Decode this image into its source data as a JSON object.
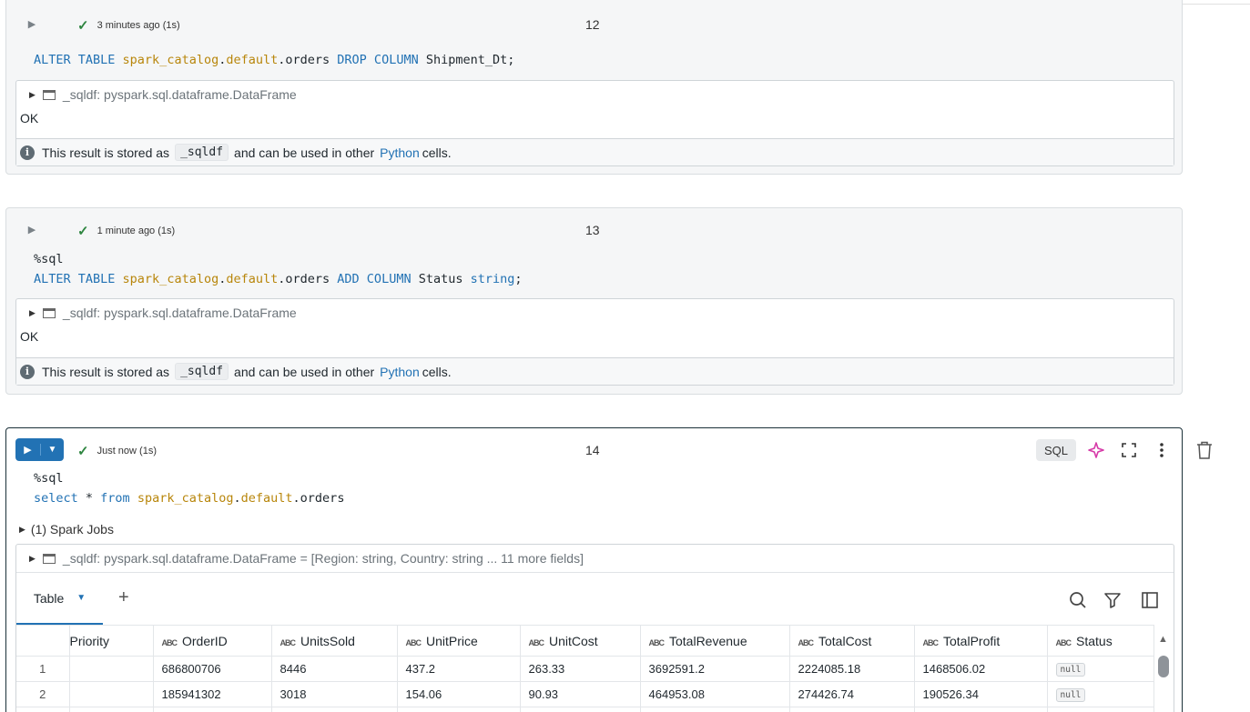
{
  "cells": [
    {
      "number": "12",
      "status": "3 minutes ago (1s)",
      "code_lines": [
        [
          {
            "t": "ALTER TABLE ",
            "c": "kw"
          },
          {
            "t": "spark_catalog",
            "c": "ident"
          },
          {
            "t": ".",
            "c": ""
          },
          {
            "t": "default",
            "c": "ident"
          },
          {
            "t": ".orders ",
            "c": ""
          },
          {
            "t": "DROP COLUMN ",
            "c": "kw"
          },
          {
            "t": "Shipment_Dt;",
            "c": ""
          }
        ]
      ],
      "result_header": "_sqldf:  pyspark.sql.dataframe.DataFrame",
      "result_text": "OK",
      "info_prefix": "This result is stored as",
      "info_code": "_sqldf",
      "info_middle": "and can be used in other",
      "info_link": "Python",
      "info_suffix": "cells."
    },
    {
      "number": "13",
      "status": "1 minute ago (1s)",
      "code_lines": [
        [
          {
            "t": "%sql",
            "c": ""
          }
        ],
        [
          {
            "t": "ALTER TABLE ",
            "c": "kw"
          },
          {
            "t": "spark_catalog",
            "c": "ident"
          },
          {
            "t": ".",
            "c": ""
          },
          {
            "t": "default",
            "c": "ident"
          },
          {
            "t": ".orders ",
            "c": ""
          },
          {
            "t": "ADD COLUMN ",
            "c": "kw"
          },
          {
            "t": "Status ",
            "c": ""
          },
          {
            "t": "string",
            "c": "kw"
          },
          {
            "t": ";",
            "c": ""
          }
        ]
      ],
      "result_header": "_sqldf:  pyspark.sql.dataframe.DataFrame",
      "result_text": "OK",
      "info_prefix": "This result is stored as",
      "info_code": "_sqldf",
      "info_middle": "and can be used in other",
      "info_link": "Python",
      "info_suffix": "cells."
    },
    {
      "number": "14",
      "status": "Just now (1s)",
      "language_badge": "SQL",
      "code_lines": [
        [
          {
            "t": "%sql",
            "c": ""
          }
        ],
        [
          {
            "t": "select",
            "c": "kw"
          },
          {
            "t": " * ",
            "c": ""
          },
          {
            "t": "from",
            "c": "kw"
          },
          {
            "t": " ",
            "c": ""
          },
          {
            "t": "spark_catalog",
            "c": "ident"
          },
          {
            "t": ".",
            "c": ""
          },
          {
            "t": "default",
            "c": "ident"
          },
          {
            "t": ".orders",
            "c": ""
          }
        ]
      ],
      "spark_jobs": "(1) Spark Jobs",
      "result_header": "_sqldf:  pyspark.sql.dataframe.DataFrame = [Region: string, Country: string ... 11 more fields]",
      "tab_label": "Table",
      "table": {
        "columns": [
          {
            "label": "",
            "typed": false
          },
          {
            "label": "Priority",
            "typed": false
          },
          {
            "label": "OrderID",
            "typed": true
          },
          {
            "label": "UnitsSold",
            "typed": true
          },
          {
            "label": "UnitPrice",
            "typed": true
          },
          {
            "label": "UnitCost",
            "typed": true
          },
          {
            "label": "TotalRevenue",
            "typed": true
          },
          {
            "label": "TotalCost",
            "typed": true
          },
          {
            "label": "TotalProfit",
            "typed": true
          },
          {
            "label": "Status",
            "typed": true
          }
        ],
        "type_glyph": "ABC",
        "rows": [
          [
            "1",
            "",
            "686800706",
            "8446",
            "437.2",
            "263.33",
            "3692591.2",
            "2224085.18",
            "1468506.02",
            "null"
          ],
          [
            "2",
            "",
            "185941302",
            "3018",
            "154.06",
            "90.93",
            "464953.08",
            "274426.74",
            "190526.34",
            "null"
          ],
          [
            "",
            "",
            "",
            "",
            "",
            "",
            "",
            "",
            "",
            ""
          ]
        ]
      }
    }
  ],
  "colors": {
    "accent": "#2272b4",
    "keyword": "#2272b4",
    "identifier": "#b8860b",
    "success": "#2e8540"
  }
}
